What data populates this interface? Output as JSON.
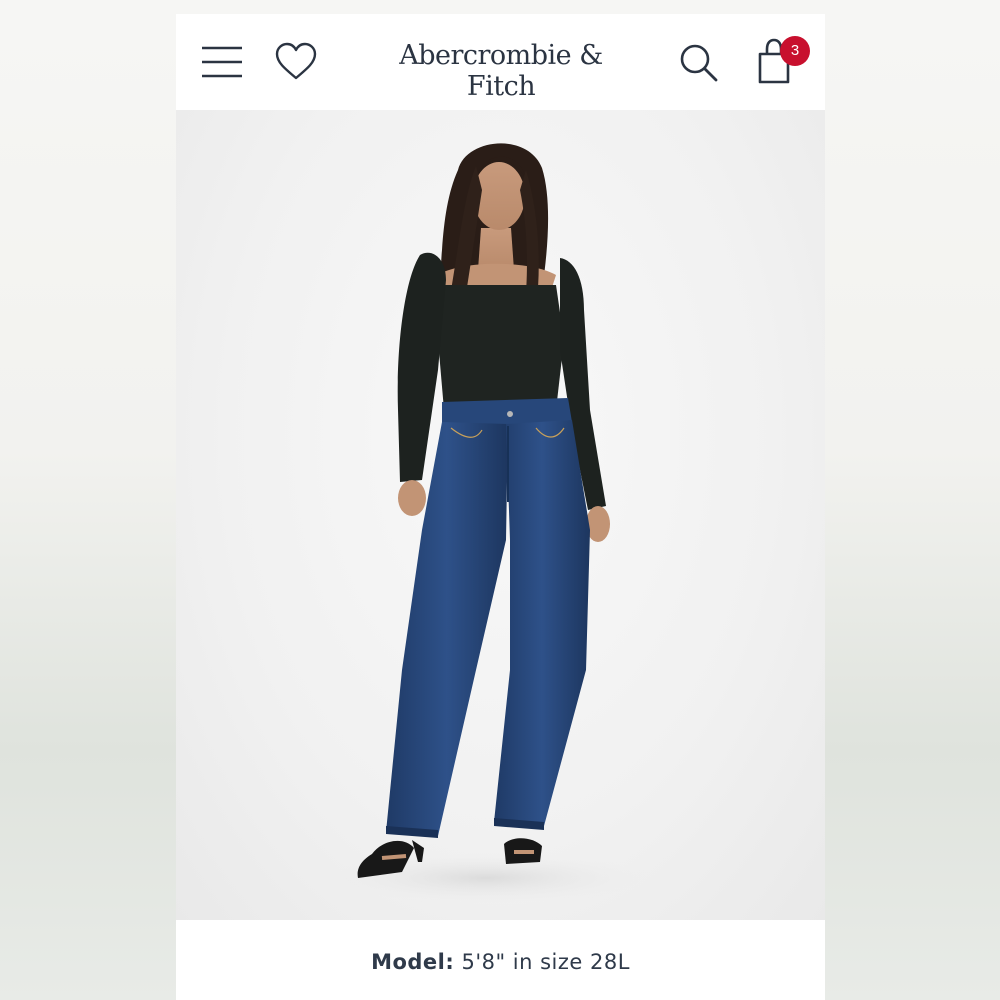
{
  "header": {
    "brand": "Abercrombie & Fitch",
    "menu_icon": "hamburger-menu-icon",
    "wishlist_icon": "heart-icon",
    "search_icon": "search-icon",
    "bag_icon": "shopping-bag-icon",
    "bag_count": "3"
  },
  "product": {
    "caption_label": "Model:",
    "caption_value": "5'8\" in size 28L"
  },
  "colors": {
    "brand_text": "#2b3442",
    "badge": "#c8102e",
    "denim": "#27477a",
    "top": "#1f2421"
  }
}
